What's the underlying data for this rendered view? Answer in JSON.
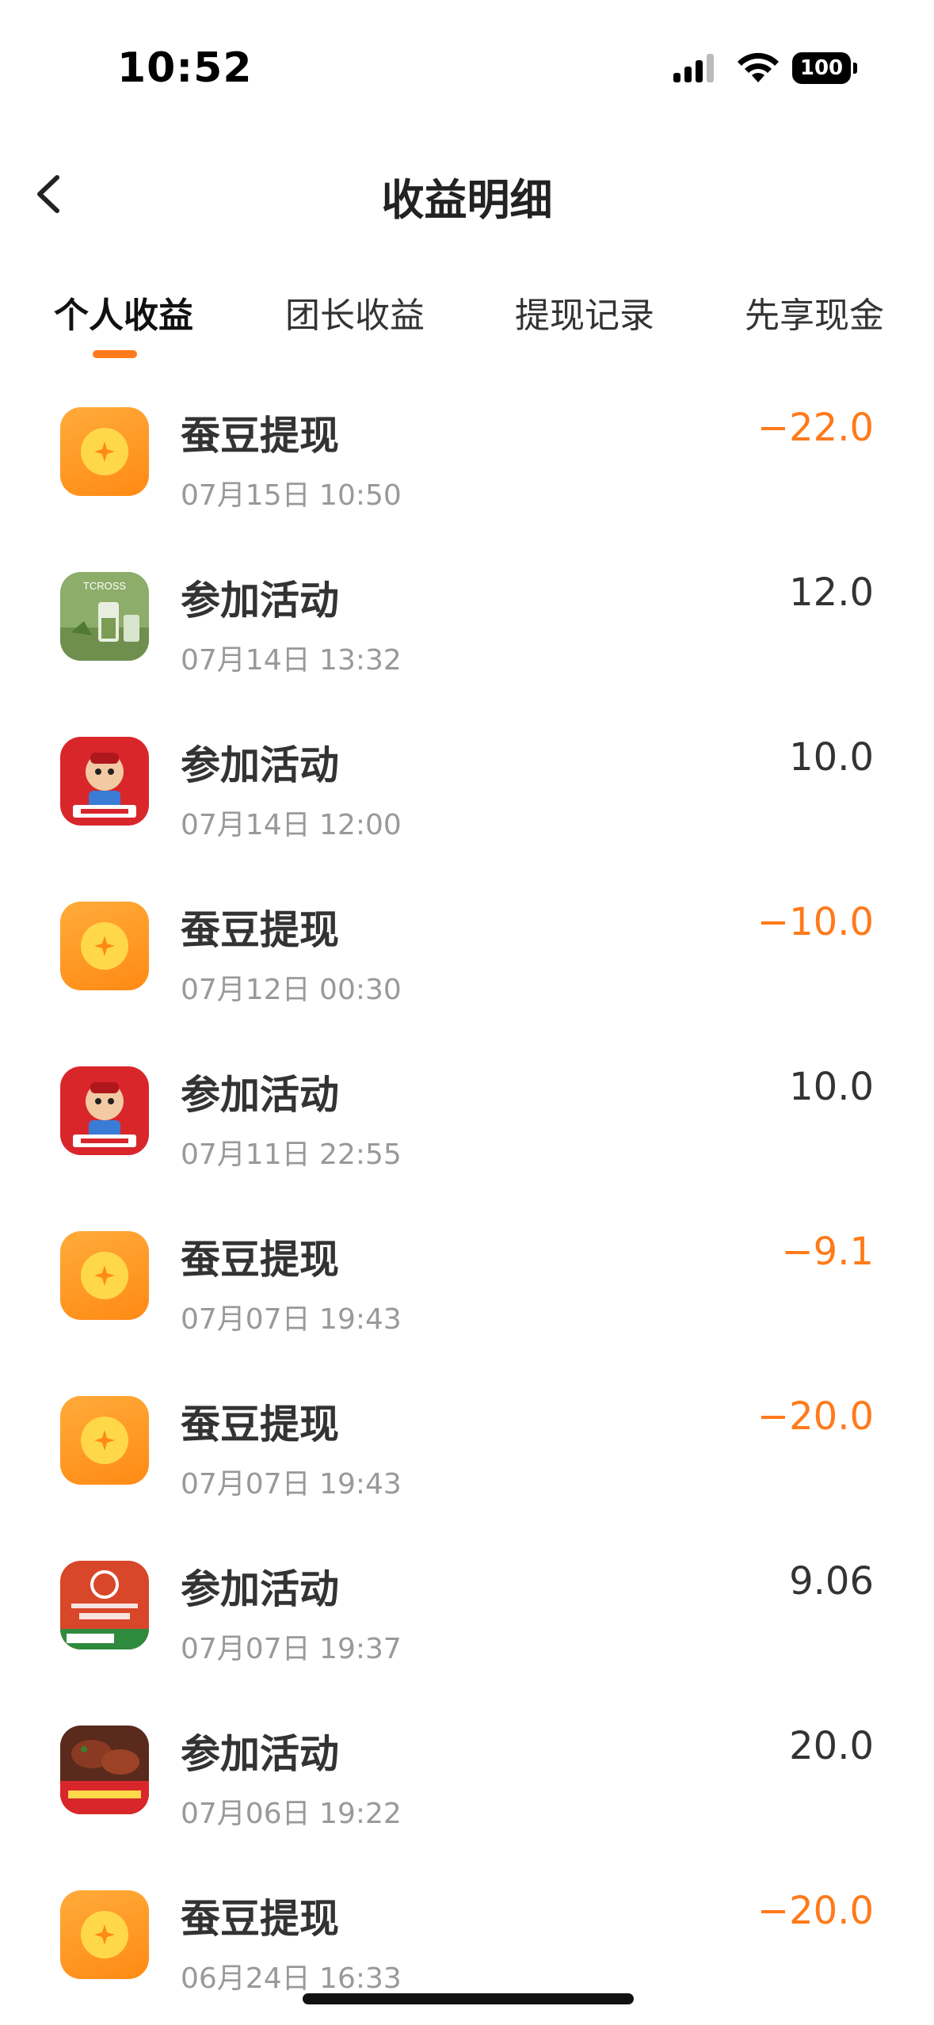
{
  "status_bar": {
    "time": "10:52",
    "battery": "100"
  },
  "nav": {
    "title": "收益明细"
  },
  "tabs": [
    {
      "label": "个人收益",
      "active": true
    },
    {
      "label": "团长收益",
      "active": false
    },
    {
      "label": "提现记录",
      "active": false
    },
    {
      "label": "先享现金",
      "active": false
    }
  ],
  "records": [
    {
      "icon": "coin-icon",
      "title": "蚕豆提现",
      "time": "07月15日 10:50",
      "amount": "−22.0",
      "negative": true
    },
    {
      "icon": "tcross-store-thumbnail",
      "title": "参加活动",
      "time": "07月14日 13:32",
      "amount": "12.0",
      "negative": false
    },
    {
      "icon": "liuxiaoxie-store-thumbnail",
      "title": "参加活动",
      "time": "07月14日 12:00",
      "amount": "10.0",
      "negative": false
    },
    {
      "icon": "coin-icon",
      "title": "蚕豆提现",
      "time": "07月12日 00:30",
      "amount": "−10.0",
      "negative": true
    },
    {
      "icon": "liuxiaoxie-store-thumbnail",
      "title": "参加活动",
      "time": "07月11日 22:55",
      "amount": "10.0",
      "negative": false
    },
    {
      "icon": "coin-icon",
      "title": "蚕豆提现",
      "time": "07月07日 19:43",
      "amount": "−9.1",
      "negative": true
    },
    {
      "icon": "coin-icon",
      "title": "蚕豆提现",
      "time": "07月07日 19:43",
      "amount": "−20.0",
      "negative": true
    },
    {
      "icon": "yangguofu-store-thumbnail",
      "title": "参加活动",
      "time": "07月07日 19:37",
      "amount": "9.06",
      "negative": false
    },
    {
      "icon": "bbq-ribs-store-thumbnail",
      "title": "参加活动",
      "time": "07月06日 19:22",
      "amount": "20.0",
      "negative": false
    },
    {
      "icon": "coin-icon",
      "title": "蚕豆提现",
      "time": "06月24日 16:33",
      "amount": "−20.0",
      "negative": true
    }
  ],
  "colors": {
    "accent": "#ff7a1a",
    "text": "#333333",
    "muted": "#999999"
  }
}
